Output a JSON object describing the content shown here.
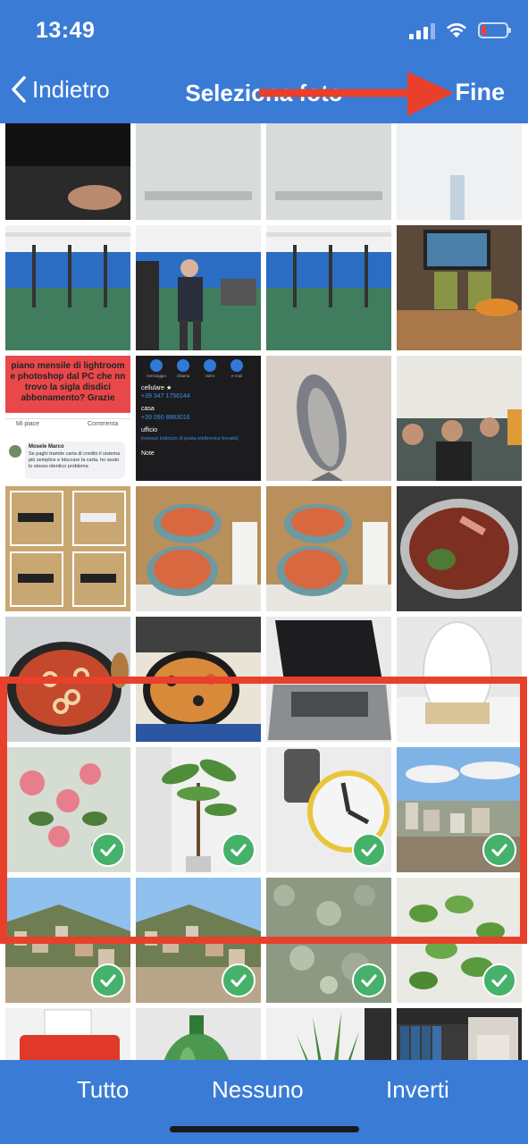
{
  "status": {
    "time": "13:49"
  },
  "nav": {
    "back_label": "Indietro",
    "title": "Seleziona foto",
    "done_label": "Fine"
  },
  "colors": {
    "bar": "#3a7bd5",
    "check": "#45b16a",
    "annotation": "#e8402a"
  },
  "photos": [
    {
      "desc": "screen-hand",
      "selected": false
    },
    {
      "desc": "gray-screen",
      "selected": false
    },
    {
      "desc": "gray-screen",
      "selected": false
    },
    {
      "desc": "bottle",
      "selected": false
    },
    {
      "desc": "gym-hall",
      "selected": false
    },
    {
      "desc": "gym-man",
      "selected": false
    },
    {
      "desc": "gym-hall",
      "selected": false
    },
    {
      "desc": "drinks-tv",
      "selected": false
    },
    {
      "desc": "facebook-post",
      "selected": false
    },
    {
      "desc": "contact-card",
      "selected": false
    },
    {
      "desc": "fish",
      "selected": false
    },
    {
      "desc": "sofa-people",
      "selected": false
    },
    {
      "desc": "floor-figures",
      "selected": false
    },
    {
      "desc": "shrimp-plates",
      "selected": false
    },
    {
      "desc": "shrimp-plates",
      "selected": false
    },
    {
      "desc": "soup-pot",
      "selected": false
    },
    {
      "desc": "pasta-pan",
      "selected": false
    },
    {
      "desc": "paella",
      "selected": false
    },
    {
      "desc": "laptop",
      "selected": false
    },
    {
      "desc": "diffuser",
      "selected": false
    },
    {
      "desc": "pink-flowers",
      "selected": true
    },
    {
      "desc": "potted-plant",
      "selected": true
    },
    {
      "desc": "clock",
      "selected": true
    },
    {
      "desc": "city-view",
      "selected": true
    },
    {
      "desc": "hill-town",
      "selected": true
    },
    {
      "desc": "hill-town",
      "selected": true
    },
    {
      "desc": "shrub",
      "selected": true
    },
    {
      "desc": "mint-plant",
      "selected": true
    },
    {
      "desc": "typewriter",
      "selected": false
    },
    {
      "desc": "green-jug",
      "selected": false
    },
    {
      "desc": "snake-plant",
      "selected": false
    },
    {
      "desc": "books-statue",
      "selected": false
    }
  ],
  "post_text": {
    "headline": "piano mensile di lightroom e photoshop dal PC che nn trovo la sigla disdici abbonamento? Grazie",
    "like": "Mi piace",
    "comment": "Commenta",
    "reply_name": "Mosele Marco",
    "reply_text": "Se paghi tramite carta di credito il sistema più semplice e bloccare la carta, ho avuto lo stesso identico problema"
  },
  "contact_text": {
    "actions": [
      "messaggio",
      "chiama",
      "video",
      "e-mail"
    ],
    "mobile_label": "cellulare ★",
    "mobile_value": "+39 347 1756144",
    "home_label": "casa",
    "home_value": "+39 090 8883016",
    "office_label": "ufficio",
    "office_value": "[nessun indirizzo di posta elettronica trovato]",
    "notes_label": "Note"
  },
  "toolbar": {
    "all_label": "Tutto",
    "none_label": "Nessuno",
    "invert_label": "Inverti"
  }
}
